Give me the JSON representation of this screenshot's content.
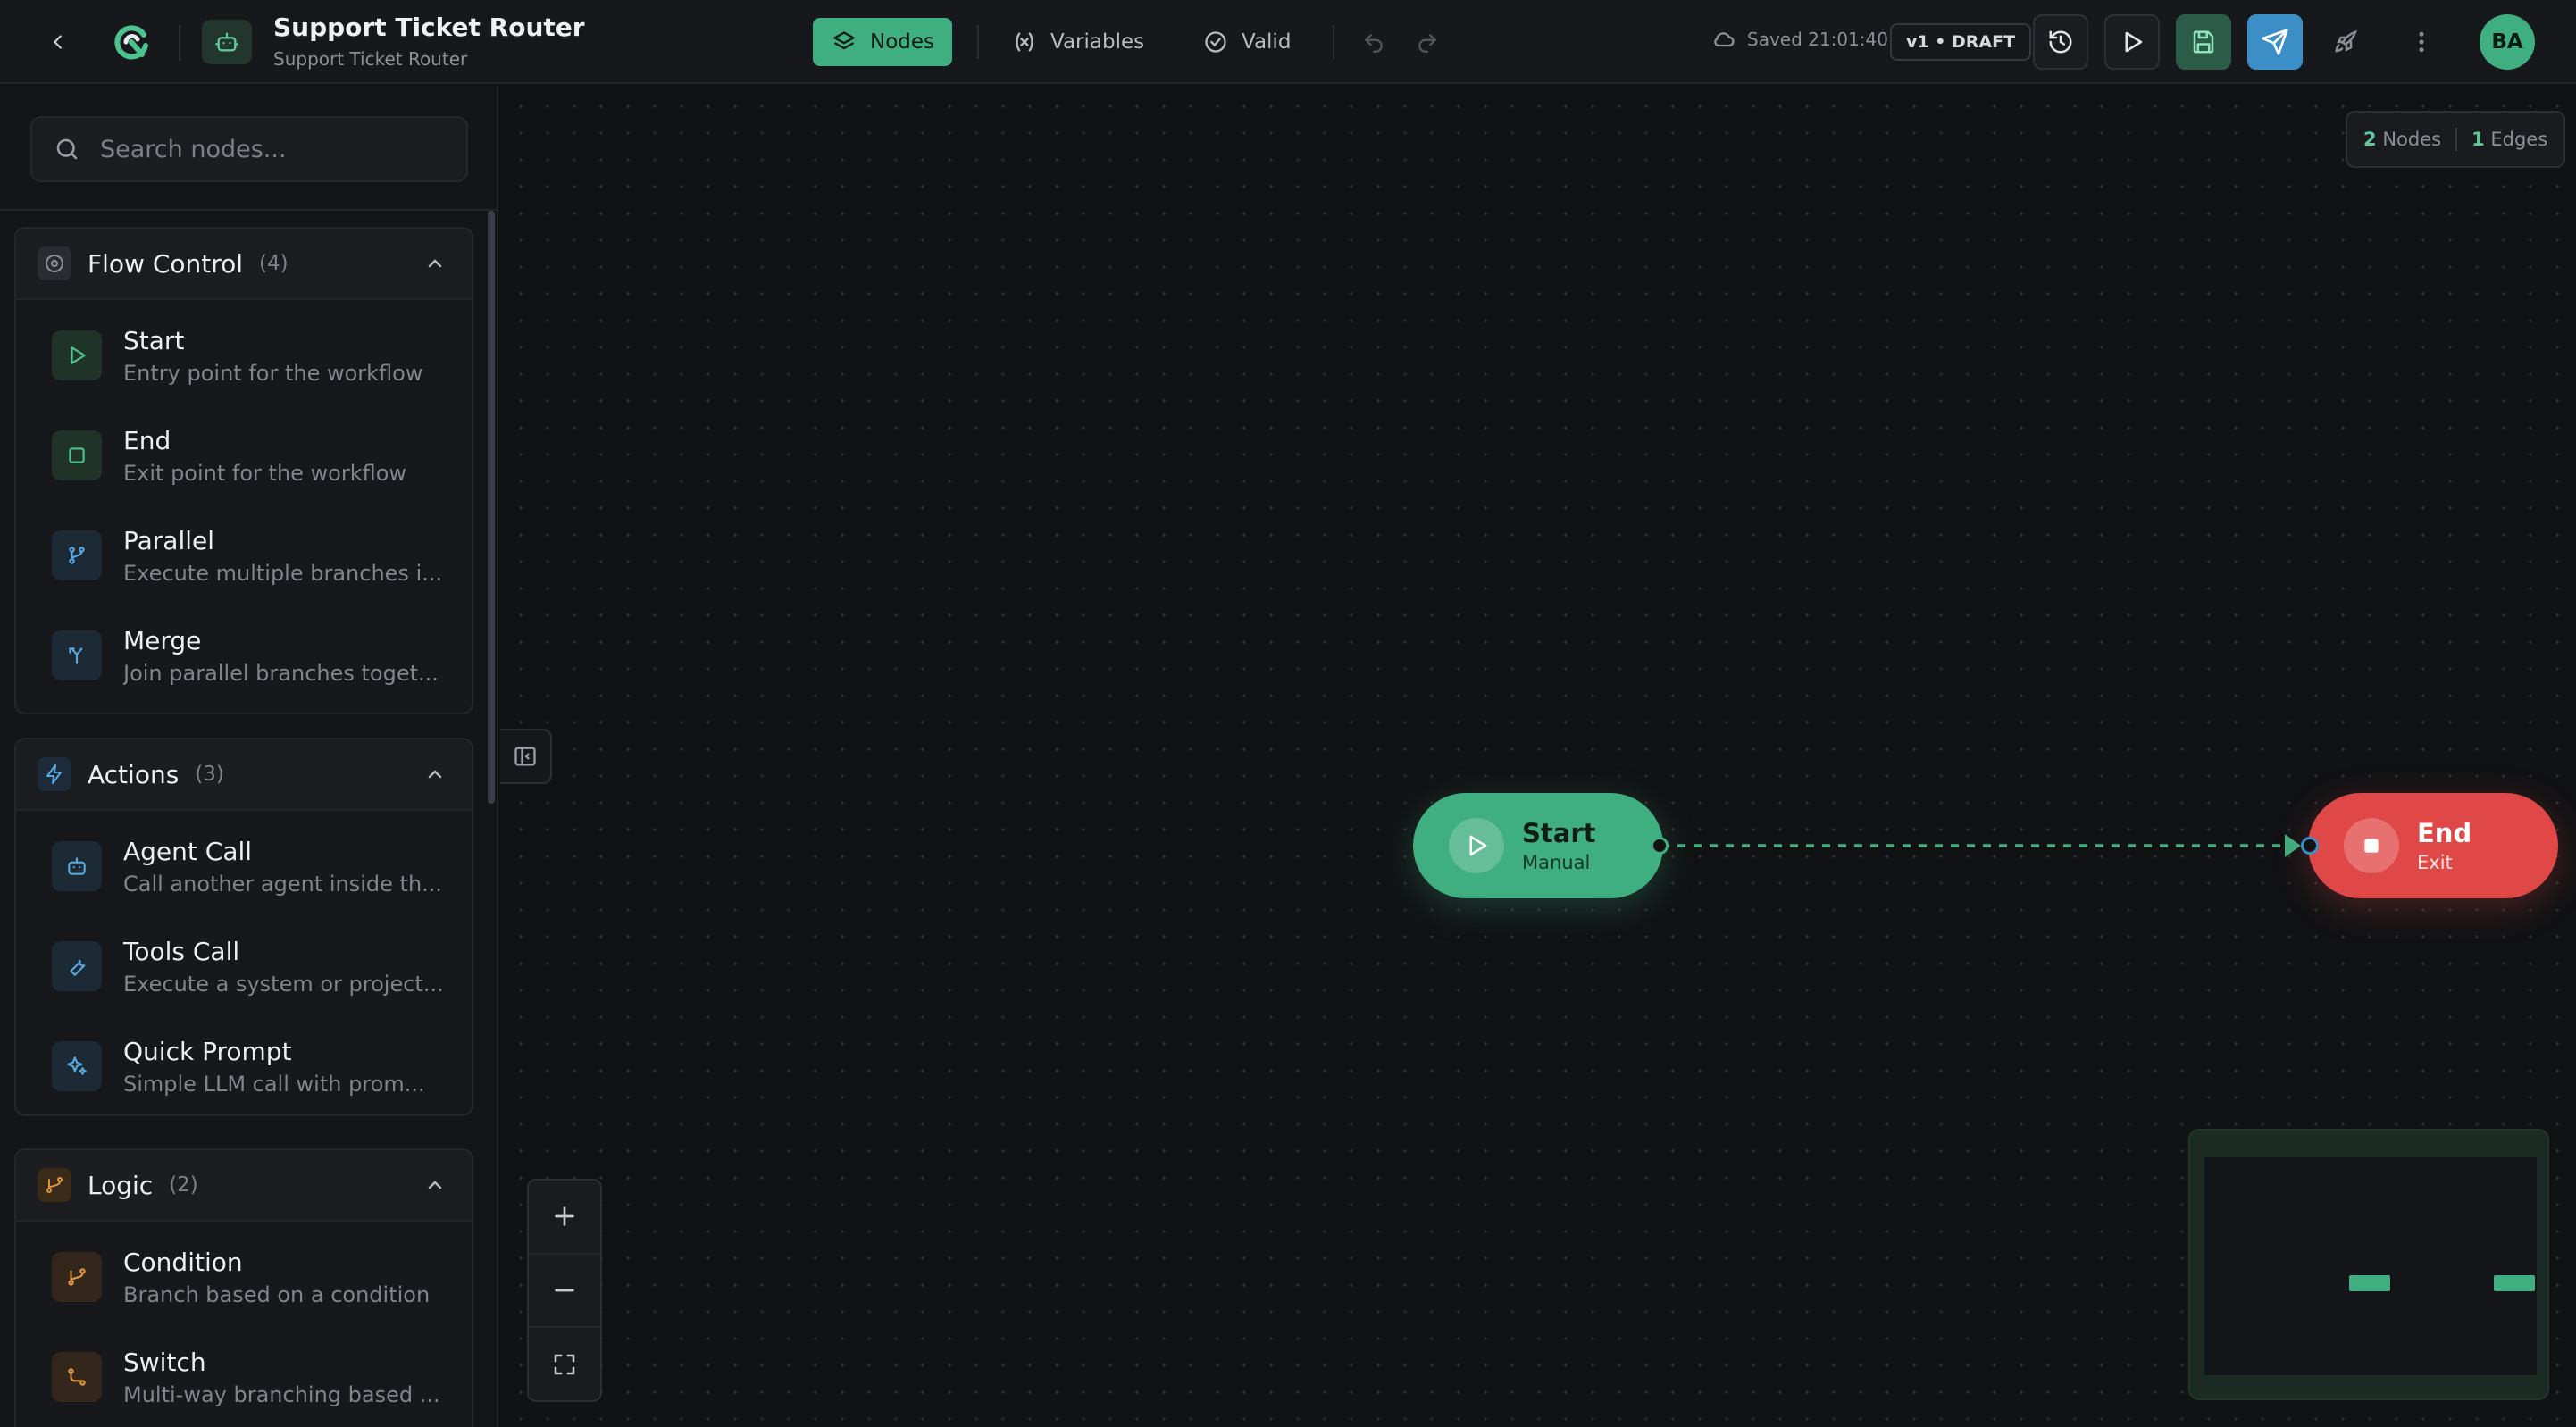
{
  "header": {
    "title": "Support Ticket Router",
    "subtitle": "Support Ticket Router",
    "tabs": [
      {
        "label": "Nodes",
        "icon": "layers-icon",
        "active": true
      },
      {
        "label": "Variables",
        "icon": "variable-icon",
        "active": false
      },
      {
        "label": "Valid",
        "icon": "check-circle-icon",
        "active": false
      }
    ],
    "saved_text": "Saved 21:01:40",
    "version_badge": "v1 • DRAFT",
    "avatar_initials": "BA",
    "accent_color": "#3fae80",
    "publish_color": "#3b8fc6"
  },
  "sidebar": {
    "search_placeholder": "Search nodes...",
    "sections": [
      {
        "title": "Flow Control",
        "count": "(4)",
        "icon": "target-icon",
        "items": [
          {
            "name": "Start",
            "desc": "Entry point for the workflow",
            "icon": "play-icon"
          },
          {
            "name": "End",
            "desc": "Exit point for the workflow",
            "icon": "square-icon"
          },
          {
            "name": "Parallel",
            "desc": "Execute multiple branches i...",
            "icon": "git-fork-icon"
          },
          {
            "name": "Merge",
            "desc": "Join parallel branches toget...",
            "icon": "merge-icon"
          }
        ]
      },
      {
        "title": "Actions",
        "count": "(3)",
        "icon": "lightning-icon",
        "items": [
          {
            "name": "Agent Call",
            "desc": "Call another agent inside th...",
            "icon": "bot-icon"
          },
          {
            "name": "Tools Call",
            "desc": "Execute a system or project...",
            "icon": "wrench-icon"
          },
          {
            "name": "Quick Prompt",
            "desc": "Simple LLM call with prom...",
            "icon": "sparkles-icon"
          }
        ]
      },
      {
        "title": "Logic",
        "count": "(2)",
        "icon": "branch-icon",
        "items": [
          {
            "name": "Condition",
            "desc": "Branch based on a condition",
            "icon": "git-branch-icon"
          },
          {
            "name": "Switch",
            "desc": "Multi-way branching based ...",
            "icon": "route-icon"
          }
        ]
      }
    ]
  },
  "canvas": {
    "stats": {
      "nodes_count": "2",
      "nodes_label": "Nodes",
      "edges_count": "1",
      "edges_label": "Edges"
    },
    "nodes": [
      {
        "title": "Start",
        "subtitle": "Manual",
        "color": "#3fae80"
      },
      {
        "title": "End",
        "subtitle": "Exit",
        "color": "#e04848"
      }
    ]
  }
}
